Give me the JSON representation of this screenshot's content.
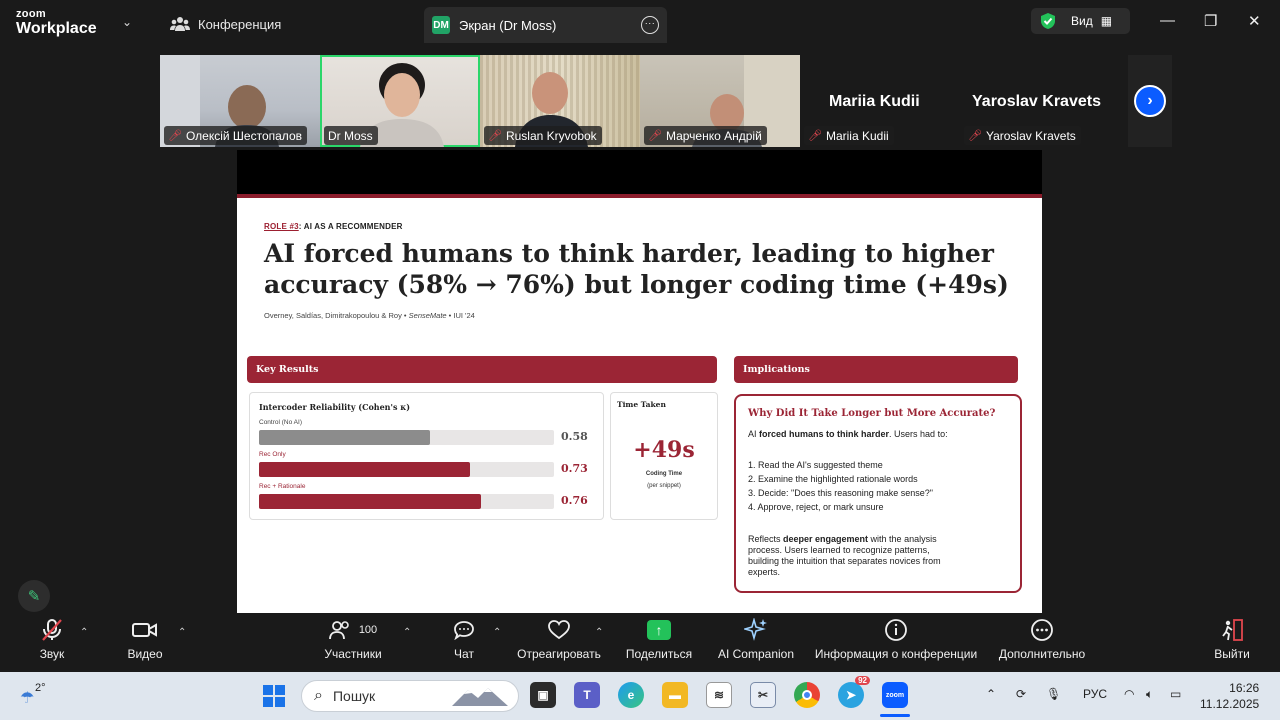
{
  "titlebar": {
    "logo_line1": "zoom",
    "logo_line2": "Workplace",
    "conference_tab": "Конференция",
    "screen_tab_badge": "DM",
    "screen_tab": "Экран (Dr Moss)",
    "view_label": "Вид"
  },
  "participants": [
    {
      "name": "Олексій Шестопалов"
    },
    {
      "name": "Dr Moss"
    },
    {
      "name": "Ruslan Kryvobok"
    },
    {
      "name": "Марченко Андрій"
    },
    {
      "name": "Mariia Kudii",
      "big": "Mariia Kudii"
    },
    {
      "name": "Yaroslav Kravets",
      "big": "Yaroslav Kravets"
    }
  ],
  "slide": {
    "role_prefix": "ROLE #3",
    "role_suffix": ": AI AS A RECOMMENDER",
    "headline": "AI forced humans to think harder, leading to higher accuracy (58% → 76%) but longer coding time (+49s)",
    "authors_pre": "Overney, Saldías, Dimitrakopoulou & Roy • ",
    "authors_italic": "SenseMate",
    "authors_post": " • IUI '24",
    "key_results_title": "Key Results",
    "implications_title": "Implications",
    "reliability_title": "Intercoder Reliability (Cohen's κ)",
    "bars": [
      {
        "label": "Control (No AI)",
        "value": 0.58,
        "display": "0.58",
        "color": "#8c8c8c",
        "label_color": "#444444"
      },
      {
        "label": "Rec Only",
        "value": 0.73,
        "display": "0.73",
        "color": "#9b2535",
        "label_color": "#9b2535"
      },
      {
        "label": "Rec + Rationale",
        "value": 0.76,
        "display": "0.76",
        "color": "#9b2535",
        "label_color": "#9b2535"
      }
    ],
    "time_taken_title": "Time Taken",
    "time_big": "+49s",
    "time_sub1": "Coding Time",
    "time_sub2": "(per snippet)",
    "impl_heading": "Why Did It Take Longer but More Accurate?",
    "impl_intro_pre": "AI ",
    "impl_intro_bold": "forced humans to think harder",
    "impl_intro_post": ". Users had to:",
    "impl_steps": [
      "1. Read the AI's suggested theme",
      "2. Examine the highlighted rationale words",
      "3. Decide: \"Does this reasoning make sense?\"",
      "4. Approve, reject, or mark unsure"
    ],
    "impl_outro_pre": "Reflects ",
    "impl_outro_bold": "deeper engagement",
    "impl_outro_l1": " with the analysis",
    "impl_outro_l2": "process. Users learned to recognize patterns,",
    "impl_outro_l3": "building the intuition that separates novices from",
    "impl_outro_l4": "experts."
  },
  "toolbar": {
    "audio": "Звук",
    "video": "Видео",
    "participants": "Участники",
    "participants_count": "100",
    "chat": "Чат",
    "react": "Отреагировать",
    "share": "Поделиться",
    "ai": "AI Companion",
    "info": "Информация о конференции",
    "more": "Дополнительно",
    "leave": "Выйти"
  },
  "taskbar": {
    "weather": "2°",
    "search_placeholder": "Пошук",
    "telegram_badge": "92",
    "zoom_label": "zoom",
    "lang": "РУС",
    "time": "16:26",
    "date": "11.12.2025"
  },
  "colors": {
    "accent": "#9b2535",
    "active_speaker": "#2bd66a",
    "zoom_blue": "#0b5cff"
  }
}
